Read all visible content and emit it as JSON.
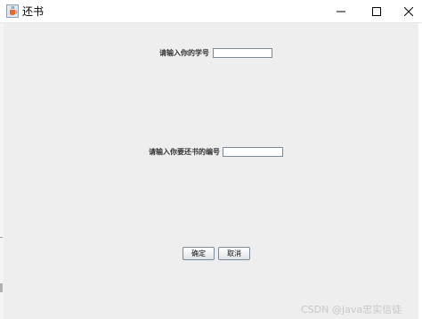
{
  "window": {
    "title": "还书",
    "icon": "java-cup-icon",
    "controls": {
      "minimize_icon": "minimize-icon",
      "maximize_icon": "maximize-icon",
      "close_icon": "close-icon"
    }
  },
  "form": {
    "student_id_label": "请输入你的学号",
    "student_id_value": "",
    "book_id_label": "请输入你要还书的编号",
    "book_id_value": ""
  },
  "buttons": {
    "confirm_label": "确定",
    "cancel_label": "取消"
  },
  "watermark": {
    "text": "CSDN @Java忠实信徒"
  },
  "colors": {
    "content_background": "#eeeeee",
    "titlebar_background": "#ffffff",
    "field_border": "#7a8a99"
  }
}
